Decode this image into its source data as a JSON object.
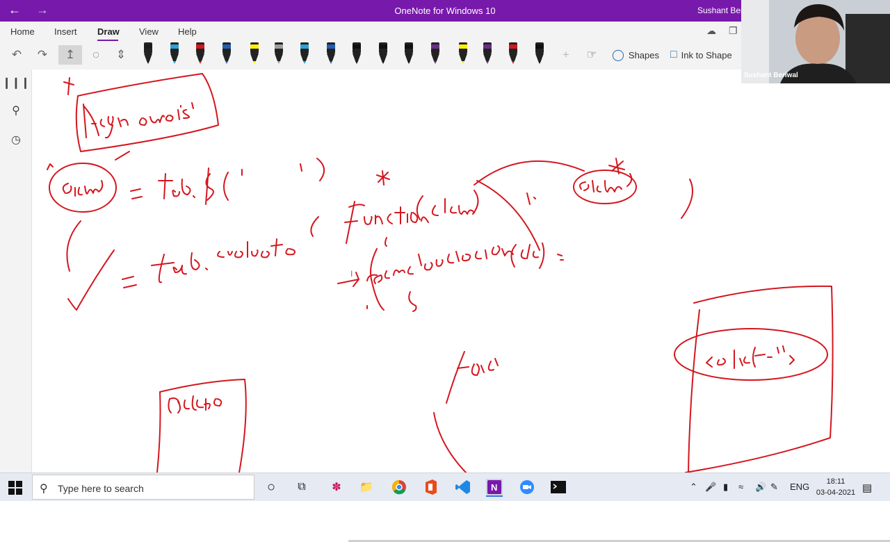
{
  "window": {
    "title": "OneNote for Windows 10",
    "user": "Sushant Beri"
  },
  "menu": {
    "tabs": [
      "Home",
      "Insert",
      "Draw",
      "View",
      "Help"
    ],
    "active": "Draw"
  },
  "toolbar": {
    "shapes_label": "Shapes",
    "ink_to_shape_label": "Ink to Shape",
    "pens": [
      "#1b1b1b",
      "#2aa3d6",
      "#d4161e",
      "#1e5fb4",
      "#fff200",
      "#9e9e9e",
      "#2aa3d6",
      "#1e5fb4",
      "#111111",
      "#111111",
      "#111111",
      "#6b2d8a",
      "#fff200",
      "#6b2d8a",
      "#d4161e",
      "#111111"
    ]
  },
  "webcam": {
    "name": "Sushant Beriwal"
  },
  "notes": {
    "ink_color": "#d4161e"
  },
  "taskbar": {
    "search_placeholder": "Type here to search",
    "language": "ENG",
    "time": "18:11",
    "date": "03-04-2021"
  }
}
